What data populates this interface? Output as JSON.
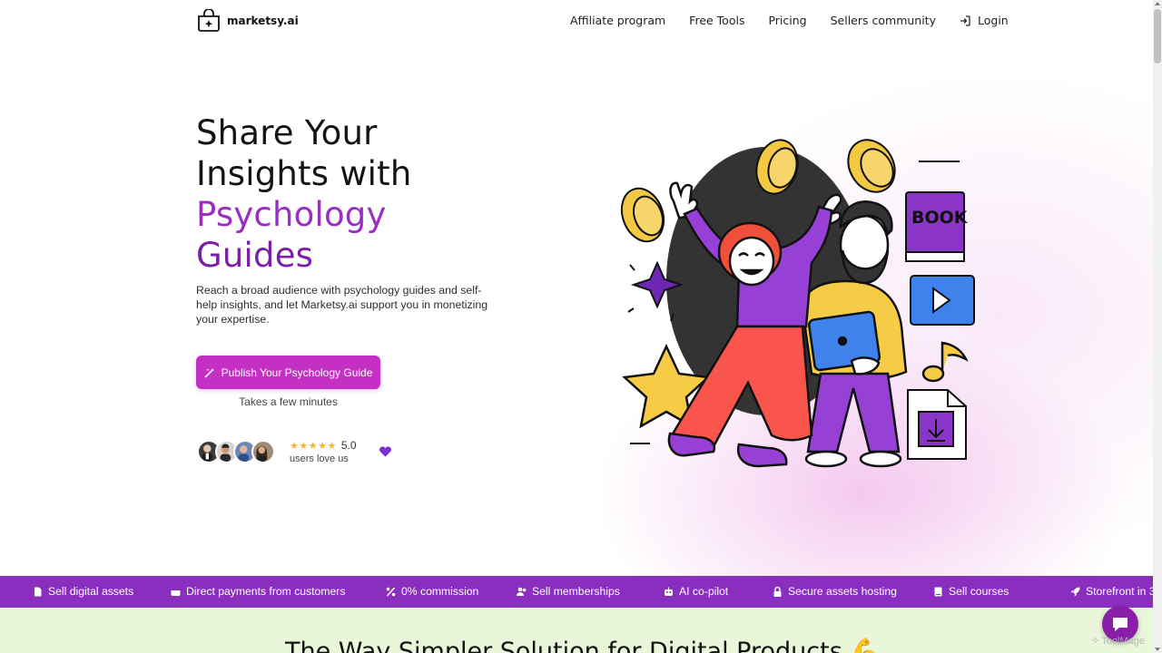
{
  "header": {
    "logo_text": "marketsy.ai",
    "nav": [
      {
        "label": "Affiliate program"
      },
      {
        "label": "Free Tools"
      },
      {
        "label": "Pricing"
      },
      {
        "label": "Sellers community"
      }
    ],
    "login_label": "Login"
  },
  "hero": {
    "title_line1": "Share Your",
    "title_line2": "Insights with",
    "title_accent1": "Psychology",
    "title_accent2": "Guides",
    "description": "Reach a broad audience with psychology guides and self-help insights, and let Marketsy.ai support you in monetizing your expertise.",
    "cta_label": "Publish Your Psychology Guide",
    "cta_sub": "Takes a few minutes",
    "rating_score": "5.0",
    "rating_caption": "users love us",
    "stars": "★★★★★",
    "illustration_book_label": "BOOK"
  },
  "features": [
    {
      "label": "Sell digital assets",
      "icon": "file-icon"
    },
    {
      "label": "Direct payments from customers",
      "icon": "wallet-icon"
    },
    {
      "label": "0% commission",
      "icon": "percent-icon"
    },
    {
      "label": "Sell memberships",
      "icon": "users-icon"
    },
    {
      "label": "AI co-pilot",
      "icon": "robot-icon"
    },
    {
      "label": "Secure assets hosting",
      "icon": "lock-icon"
    },
    {
      "label": "Sell courses",
      "icon": "book-icon"
    },
    {
      "label": "Storefront in 3",
      "icon": "rocket-icon"
    }
  ],
  "bottom_title": "The Way Simpler Solution for Digital Products 💪",
  "watermark": "ToolMage",
  "colors": {
    "accent": "#c530c4",
    "strip": "#8a2ebf",
    "title_accent": "#9a2ec2"
  }
}
